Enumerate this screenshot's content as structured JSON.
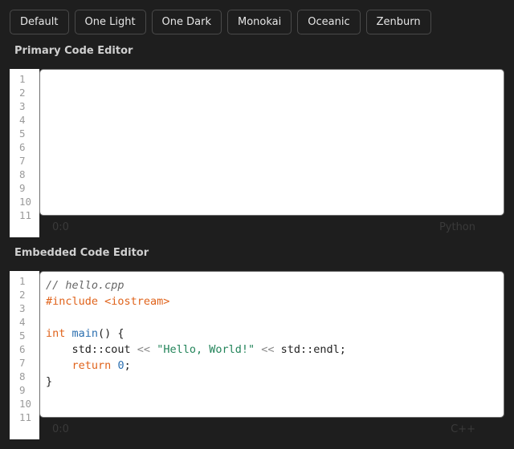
{
  "themes": [
    "Default",
    "One Light",
    "One Dark",
    "Monokai",
    "Oceanic",
    "Zenburn"
  ],
  "primary": {
    "title": "Primary Code Editor",
    "line_numbers": [
      "1",
      "2",
      "3",
      "4",
      "5",
      "6",
      "7",
      "8",
      "9",
      "10",
      "11"
    ],
    "cursor_position": "0:0",
    "language": "Python"
  },
  "embedded": {
    "title": "Embedded Code Editor",
    "line_numbers": [
      "1",
      "2",
      "3",
      "4",
      "5",
      "6",
      "7",
      "8",
      "9",
      "10",
      "11"
    ],
    "cursor_position": "0:0",
    "language": "C++",
    "code_lines": [
      [
        {
          "t": "comment",
          "v": "// hello.cpp"
        }
      ],
      [
        {
          "t": "pre",
          "v": "#include <iostream>"
        }
      ],
      [],
      [
        {
          "t": "kw",
          "v": "int"
        },
        {
          "t": "plain",
          "v": " "
        },
        {
          "t": "fn",
          "v": "main"
        },
        {
          "t": "punc",
          "v": "() {"
        }
      ],
      [
        {
          "t": "plain",
          "v": "    std::cout "
        },
        {
          "t": "op",
          "v": "<<"
        },
        {
          "t": "plain",
          "v": " "
        },
        {
          "t": "str",
          "v": "\"Hello, World!\""
        },
        {
          "t": "plain",
          "v": " "
        },
        {
          "t": "op",
          "v": "<<"
        },
        {
          "t": "plain",
          "v": " std::endl;"
        }
      ],
      [
        {
          "t": "plain",
          "v": "    "
        },
        {
          "t": "kw",
          "v": "return"
        },
        {
          "t": "plain",
          "v": " "
        },
        {
          "t": "num",
          "v": "0"
        },
        {
          "t": "punc",
          "v": ";"
        }
      ],
      [
        {
          "t": "punc",
          "v": "}"
        }
      ]
    ]
  }
}
